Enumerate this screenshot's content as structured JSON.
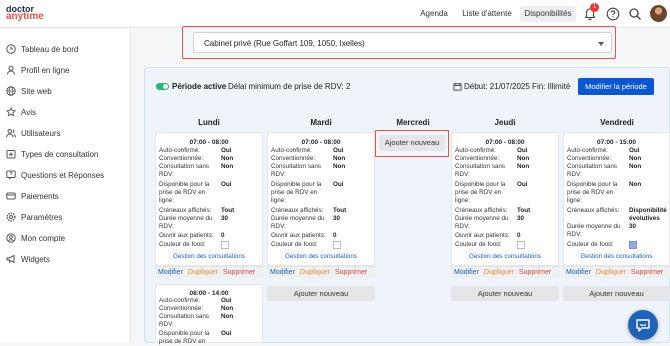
{
  "brand": {
    "line1": "doctor",
    "line2": "anytime"
  },
  "nav": {
    "agenda": "Agenda",
    "queue": "Liste d'attente",
    "availability": "Disponibilités",
    "notif_count": "1"
  },
  "sidebar": {
    "items": [
      {
        "label": "Tableau de bord",
        "icon": "clock-icon"
      },
      {
        "label": "Profil en ligne",
        "icon": "user-icon"
      },
      {
        "label": "Site web",
        "icon": "globe-icon"
      },
      {
        "label": "Avis",
        "icon": "star-icon"
      },
      {
        "label": "Utilisateurs",
        "icon": "users-icon"
      },
      {
        "label": "Types de consultation",
        "icon": "plus-box-icon"
      },
      {
        "label": "Questions et Réponses",
        "icon": "question-icon"
      },
      {
        "label": "Paiements",
        "icon": "card-icon"
      },
      {
        "label": "Paramètres",
        "icon": "gear-icon"
      },
      {
        "label": "Mon compte",
        "icon": "account-icon"
      },
      {
        "label": "Widgets",
        "icon": "megaphone-icon"
      }
    ]
  },
  "practice": {
    "selected": "Cabinet privé (Rue Goffart 109, 1050, Ixelles)"
  },
  "period": {
    "status": "Période active",
    "min_delay": "Délai minimum de prise de RDV: 2",
    "dates": "Début: 21/07/2025 Fin: Illimité",
    "modify_label": "Modifier la période"
  },
  "days": [
    "Lundi",
    "Mardi",
    "Mercredi",
    "Jeudi",
    "Vendredi"
  ],
  "labels": {
    "auto": "Auto-confirmé:",
    "conv": "Conventionnée:",
    "csr1": "Consultation sans",
    "csr2": "RDV:",
    "disp1": "Disponible pour la",
    "disp2": "prise de RDV en",
    "disp3": "ligne:",
    "cre": "Créneaux affichés:",
    "dur1": "Durée moyenne du",
    "dur2": "RDV:",
    "open": "Ouvrir aux patients:",
    "color": "Couleur de fond:",
    "manage": "Gestion des consultations",
    "modify": "Modifier",
    "duplicate": "Dupliquer",
    "delete": "Supprimer",
    "add_new": "Ajouter nouveau"
  },
  "slots": {
    "lundi1": {
      "time": "07:00 - 08:00",
      "auto": "Oui",
      "conv": "Non",
      "csr": "Non",
      "disp": "Oui",
      "cre": "Tout",
      "dur": "30",
      "open": "0"
    },
    "mardi1": {
      "time": "07:00 - 08:00",
      "auto": "Oui",
      "conv": "Non",
      "csr": "Non",
      "disp": "Oui",
      "cre": "Tout",
      "dur": "30",
      "open": "0"
    },
    "jeudi1": {
      "time": "07:00 - 08:00",
      "auto": "Oui",
      "conv": "Non",
      "csr": "Non",
      "disp": "Oui",
      "cre": "Tout",
      "dur": "30",
      "open": "0"
    },
    "vendredi1": {
      "time": "07:00 - 15:00",
      "auto": "Oui",
      "conv": "Non",
      "csr": "Non",
      "disp": "Non",
      "cre1": "Disponibilité",
      "cre2": "évolutives",
      "dur": "30"
    },
    "lundi2": {
      "time": "08:00 - 14:00",
      "auto": "Oui",
      "conv": "Non",
      "csr": "Non",
      "disp": "Oui"
    }
  },
  "colors": {
    "accent": "#0b57d0",
    "highlight": "#e8524a",
    "swatch_vendredi": "#9aa6e0"
  }
}
